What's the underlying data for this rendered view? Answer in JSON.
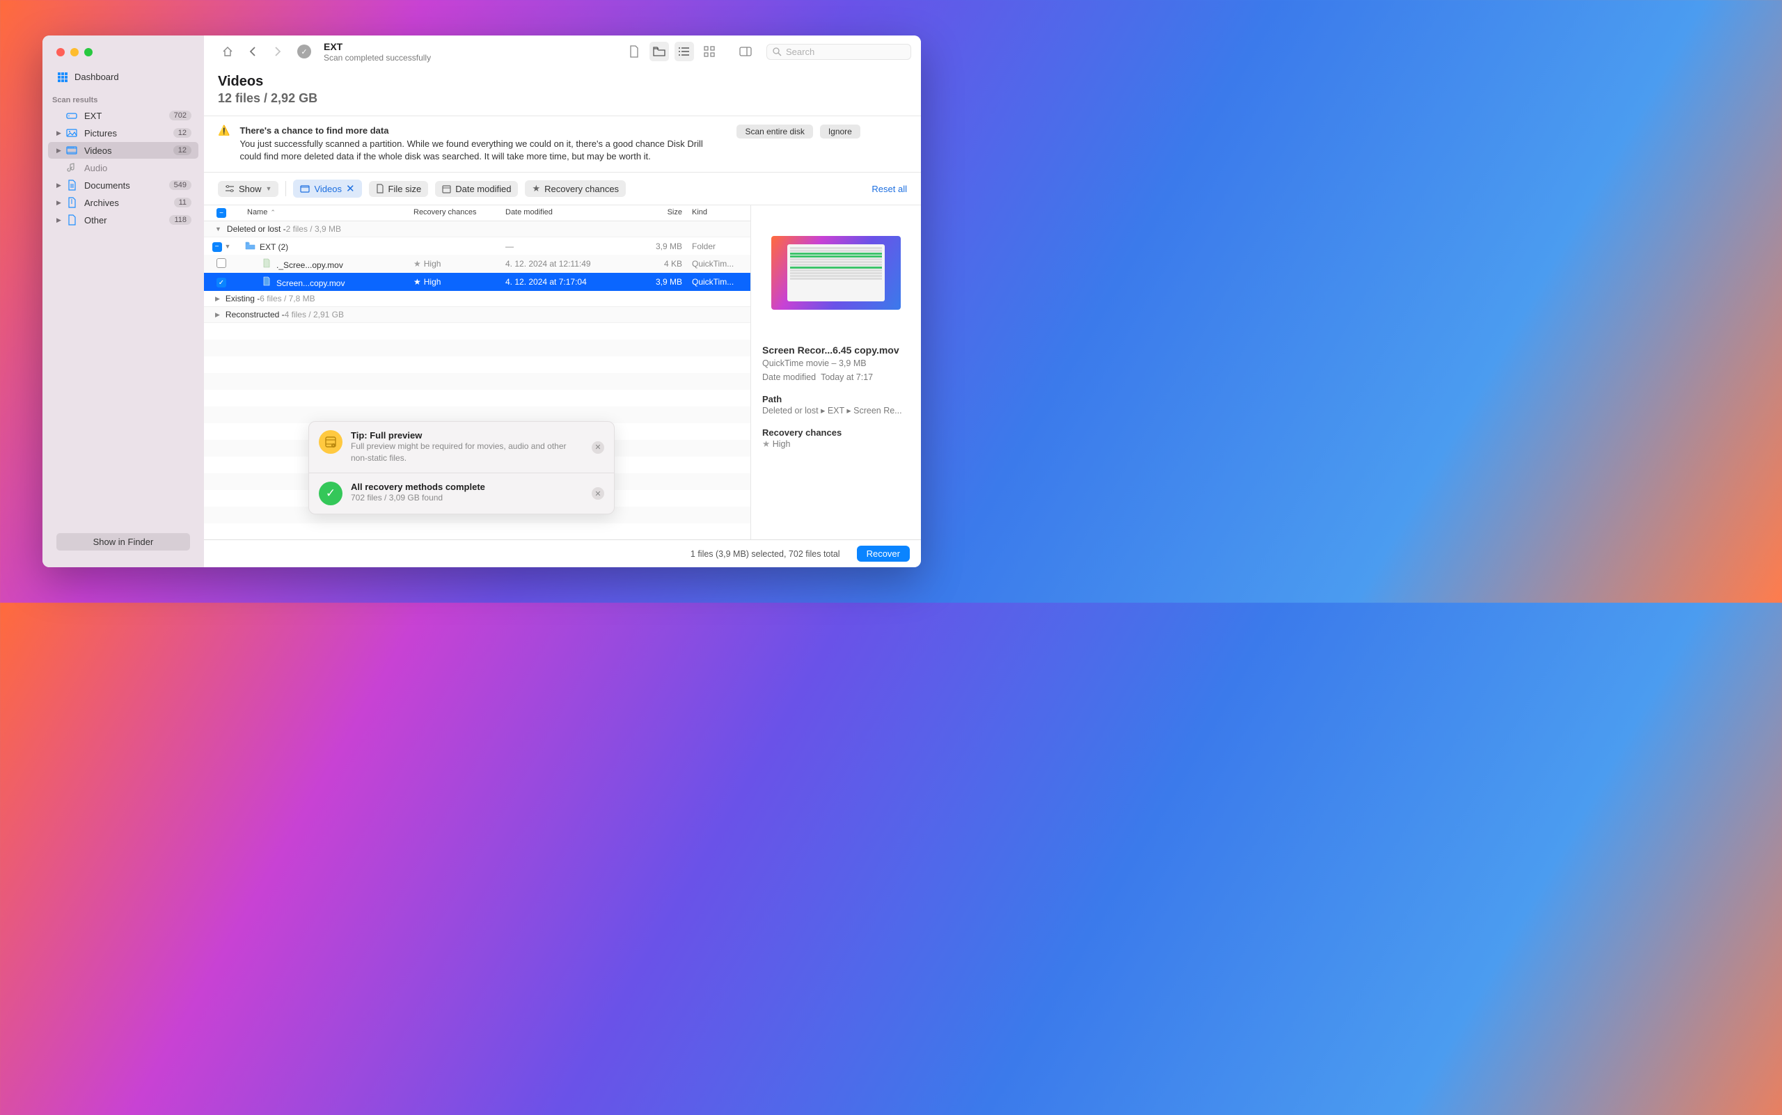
{
  "sidebar": {
    "dashboard_label": "Dashboard",
    "section_label": "Scan results",
    "items": [
      {
        "label": "EXT",
        "badge": "702",
        "icon": "drive",
        "chevron": false
      },
      {
        "label": "Pictures",
        "badge": "12",
        "icon": "picture",
        "chevron": true
      },
      {
        "label": "Videos",
        "badge": "12",
        "icon": "video",
        "chevron": true,
        "selected": true
      },
      {
        "label": "Audio",
        "badge": "",
        "icon": "audio",
        "chevron": false
      },
      {
        "label": "Documents",
        "badge": "549",
        "icon": "doc",
        "chevron": true
      },
      {
        "label": "Archives",
        "badge": "11",
        "icon": "archive",
        "chevron": true
      },
      {
        "label": "Other",
        "badge": "118",
        "icon": "other",
        "chevron": true
      }
    ],
    "show_in_finder": "Show in Finder"
  },
  "toolbar": {
    "title": "EXT",
    "subtitle": "Scan completed successfully",
    "search_placeholder": "Search"
  },
  "content": {
    "title": "Videos",
    "subtitle": "12 files / 2,92 GB"
  },
  "banner": {
    "title": "There's a chance to find more data",
    "body": "You just successfully scanned a partition. While we found everything we could on it, there's a good chance Disk Drill could find more deleted data if the whole disk was searched. It will take more time, but may be worth it.",
    "scan_button": "Scan entire disk",
    "ignore_button": "Ignore"
  },
  "filters": {
    "show": "Show",
    "videos": "Videos",
    "file_size": "File size",
    "date_modified": "Date modified",
    "recovery_chances": "Recovery chances",
    "reset_all": "Reset all"
  },
  "table": {
    "columns": {
      "name": "Name",
      "recovery": "Recovery chances",
      "date": "Date modified",
      "size": "Size",
      "kind": "Kind"
    },
    "groups": [
      {
        "label": "Deleted or lost - ",
        "meta": "2 files / 3,9 MB",
        "expanded": true
      },
      {
        "label": "Existing - ",
        "meta": "6 files / 7,8 MB",
        "expanded": false
      },
      {
        "label": "Reconstructed - ",
        "meta": "4 files / 2,91 GB",
        "expanded": false
      }
    ],
    "rows": [
      {
        "check": "minus",
        "name": "EXT (2)",
        "recovery": "",
        "date": "—",
        "size": "3,9 MB",
        "kind": "Folder",
        "icon": "folder",
        "indent": 0
      },
      {
        "check": "empty",
        "name": "._Scree...opy.mov",
        "recovery": "High",
        "date": "4. 12. 2024 at 12:11:49",
        "size": "4 KB",
        "kind": "QuickTim...",
        "icon": "file",
        "indent": 1
      },
      {
        "check": "checked",
        "name": "Screen...copy.mov",
        "recovery": "High",
        "date": "4. 12. 2024 at 7:17:04",
        "size": "3,9 MB",
        "kind": "QuickTim...",
        "icon": "file-sel",
        "indent": 1,
        "selected": true
      }
    ]
  },
  "preview": {
    "title": "Screen Recor...6.45 copy.mov",
    "subtitle": "QuickTime movie – 3,9 MB",
    "date_label": "Date modified",
    "date_value": "Today at 7:17",
    "path_label": "Path",
    "path_value": "Deleted or lost ▸ EXT ▸ Screen Re...",
    "recovery_label": "Recovery chances",
    "recovery_value": "High"
  },
  "statusbar": {
    "text": "1 files (3,9 MB) selected, 702 files total",
    "recover": "Recover"
  },
  "toasts": [
    {
      "icon": "film",
      "color": "yellow",
      "title": "Tip: Full preview",
      "desc": "Full preview might be required for movies, audio and other non-static files."
    },
    {
      "icon": "check",
      "color": "green",
      "title": "All recovery methods complete",
      "desc": "702 files / 3,09 GB found"
    }
  ]
}
